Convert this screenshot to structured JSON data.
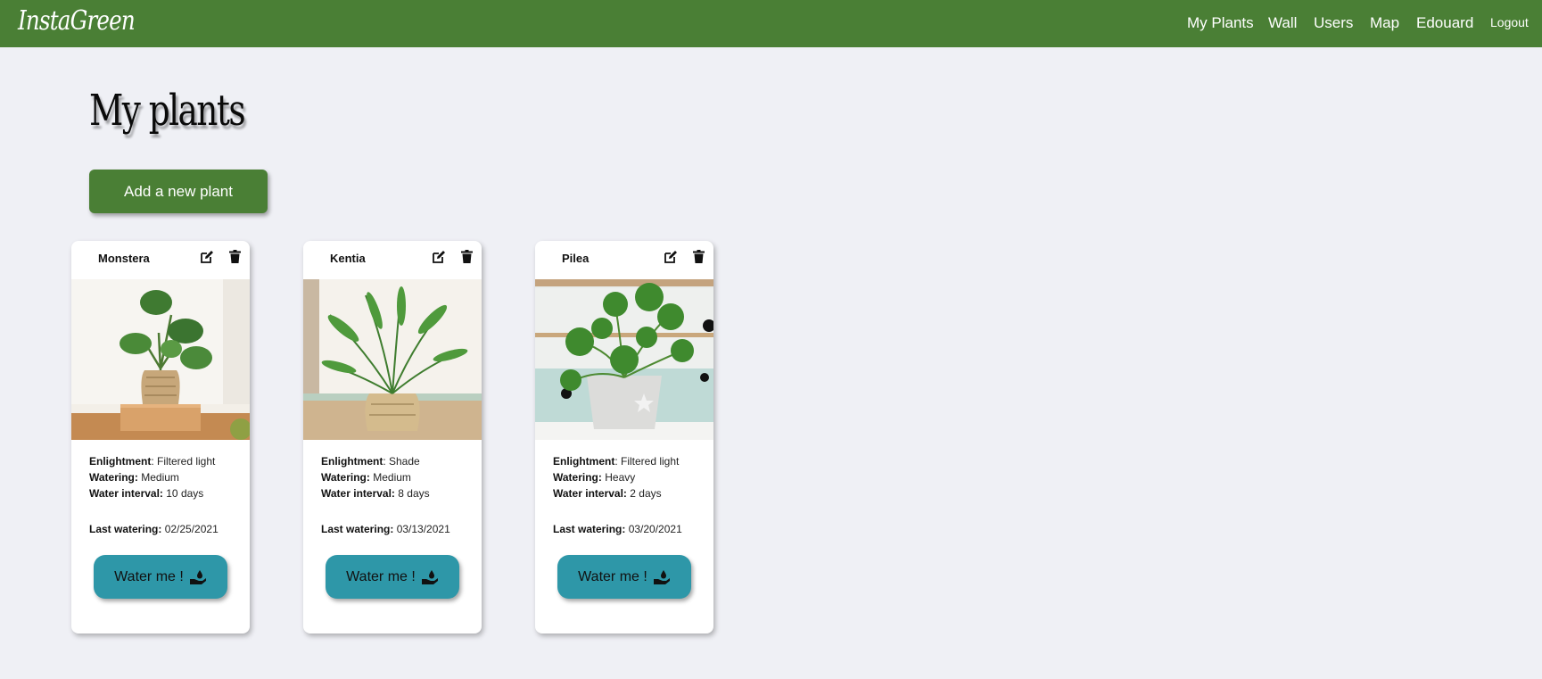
{
  "navbar": {
    "brand": "InstaGreen",
    "links": [
      "My Plants",
      "Wall",
      "Users",
      "Map",
      "Edouard"
    ],
    "logout": "Logout"
  },
  "page": {
    "title": "My plants",
    "add_button": "Add a new plant"
  },
  "labels": {
    "enlightment": "Enlightment",
    "watering": "Watering:",
    "water_interval": "Water interval:",
    "last_watering": "Last watering:",
    "water_button": "Water me !"
  },
  "plants": [
    {
      "name": "Monstera",
      "enlightment": ": Filtered light",
      "watering": " Medium",
      "water_interval": " 10 days",
      "last_watering": " 02/25/2021",
      "photo_icon": "monstera-photo"
    },
    {
      "name": "Kentia",
      "enlightment": ": Shade",
      "watering": " Medium",
      "water_interval": " 8 days",
      "last_watering": " 03/13/2021",
      "photo_icon": "kentia-photo"
    },
    {
      "name": "Pilea",
      "enlightment": ": Filtered light",
      "watering": " Heavy",
      "water_interval": " 2 days",
      "last_watering": " 03/20/2021",
      "photo_icon": "pilea-photo"
    }
  ],
  "colors": {
    "brand_green": "#4a7f35",
    "water_teal": "#2e97a8",
    "background": "#eff0f5"
  }
}
